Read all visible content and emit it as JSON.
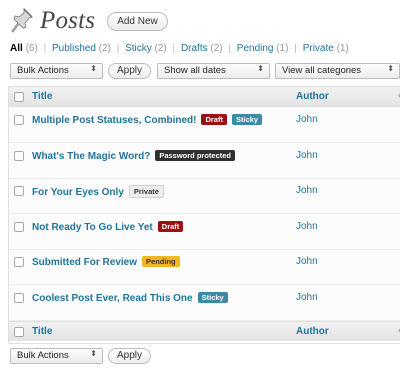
{
  "header": {
    "title": "Posts",
    "add_new_label": "Add New"
  },
  "filters": {
    "all_label": "All",
    "all_count": "(6)",
    "published_label": "Published",
    "published_count": "(2)",
    "sticky_label": "Sticky",
    "sticky_count": "(2)",
    "drafts_label": "Drafts",
    "drafts_count": "(2)",
    "pending_label": "Pending",
    "pending_count": "(1)",
    "private_label": "Private",
    "private_count": "(1)",
    "separator": "|"
  },
  "toolbar": {
    "bulk_actions": "Bulk Actions",
    "apply_label": "Apply",
    "dates": "Show all dates",
    "categories": "View all categories"
  },
  "table": {
    "col_title": "Title",
    "col_author": "Author",
    "col_more": "‹",
    "rows": [
      {
        "title": "Multiple Post Statuses, Combined!",
        "badges": [
          "Draft",
          "Sticky"
        ],
        "author": "John"
      },
      {
        "title": "What's The Magic Word?",
        "badges": [
          "Password protected"
        ],
        "author": "John"
      },
      {
        "title": "For Your Eyes Only",
        "badges": [
          "Private"
        ],
        "author": "John"
      },
      {
        "title": "Not Ready To Go Live Yet",
        "badges": [
          "Draft"
        ],
        "author": "John"
      },
      {
        "title": "Submitted For Review",
        "badges": [
          "Pending"
        ],
        "author": "John"
      },
      {
        "title": "Coolest Post Ever, Read This One",
        "badges": [
          "Sticky"
        ],
        "author": "John"
      }
    ]
  },
  "bottom_toolbar": {
    "bulk_actions": "Bulk Actions",
    "apply_label": "Apply"
  },
  "colors": {
    "link": "#21759b",
    "draft": "#9a1111",
    "sticky": "#3a8aa3",
    "password": "#303030",
    "pending": "#f0b820"
  }
}
